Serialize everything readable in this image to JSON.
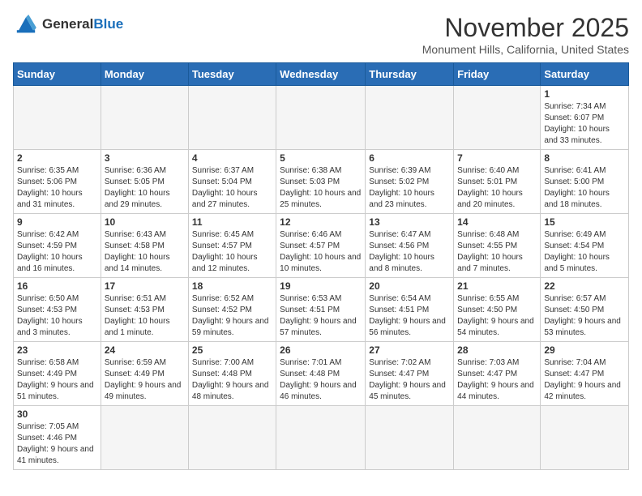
{
  "header": {
    "logo_general": "General",
    "logo_blue": "Blue",
    "month_title": "November 2025",
    "subtitle": "Monument Hills, California, United States"
  },
  "weekdays": [
    "Sunday",
    "Monday",
    "Tuesday",
    "Wednesday",
    "Thursday",
    "Friday",
    "Saturday"
  ],
  "weeks": [
    [
      {
        "day": "",
        "info": ""
      },
      {
        "day": "",
        "info": ""
      },
      {
        "day": "",
        "info": ""
      },
      {
        "day": "",
        "info": ""
      },
      {
        "day": "",
        "info": ""
      },
      {
        "day": "",
        "info": ""
      },
      {
        "day": "1",
        "info": "Sunrise: 7:34 AM\nSunset: 6:07 PM\nDaylight: 10 hours and 33 minutes."
      }
    ],
    [
      {
        "day": "2",
        "info": "Sunrise: 6:35 AM\nSunset: 5:06 PM\nDaylight: 10 hours and 31 minutes."
      },
      {
        "day": "3",
        "info": "Sunrise: 6:36 AM\nSunset: 5:05 PM\nDaylight: 10 hours and 29 minutes."
      },
      {
        "day": "4",
        "info": "Sunrise: 6:37 AM\nSunset: 5:04 PM\nDaylight: 10 hours and 27 minutes."
      },
      {
        "day": "5",
        "info": "Sunrise: 6:38 AM\nSunset: 5:03 PM\nDaylight: 10 hours and 25 minutes."
      },
      {
        "day": "6",
        "info": "Sunrise: 6:39 AM\nSunset: 5:02 PM\nDaylight: 10 hours and 23 minutes."
      },
      {
        "day": "7",
        "info": "Sunrise: 6:40 AM\nSunset: 5:01 PM\nDaylight: 10 hours and 20 minutes."
      },
      {
        "day": "8",
        "info": "Sunrise: 6:41 AM\nSunset: 5:00 PM\nDaylight: 10 hours and 18 minutes."
      }
    ],
    [
      {
        "day": "9",
        "info": "Sunrise: 6:42 AM\nSunset: 4:59 PM\nDaylight: 10 hours and 16 minutes."
      },
      {
        "day": "10",
        "info": "Sunrise: 6:43 AM\nSunset: 4:58 PM\nDaylight: 10 hours and 14 minutes."
      },
      {
        "day": "11",
        "info": "Sunrise: 6:45 AM\nSunset: 4:57 PM\nDaylight: 10 hours and 12 minutes."
      },
      {
        "day": "12",
        "info": "Sunrise: 6:46 AM\nSunset: 4:57 PM\nDaylight: 10 hours and 10 minutes."
      },
      {
        "day": "13",
        "info": "Sunrise: 6:47 AM\nSunset: 4:56 PM\nDaylight: 10 hours and 8 minutes."
      },
      {
        "day": "14",
        "info": "Sunrise: 6:48 AM\nSunset: 4:55 PM\nDaylight: 10 hours and 7 minutes."
      },
      {
        "day": "15",
        "info": "Sunrise: 6:49 AM\nSunset: 4:54 PM\nDaylight: 10 hours and 5 minutes."
      }
    ],
    [
      {
        "day": "16",
        "info": "Sunrise: 6:50 AM\nSunset: 4:53 PM\nDaylight: 10 hours and 3 minutes."
      },
      {
        "day": "17",
        "info": "Sunrise: 6:51 AM\nSunset: 4:53 PM\nDaylight: 10 hours and 1 minute."
      },
      {
        "day": "18",
        "info": "Sunrise: 6:52 AM\nSunset: 4:52 PM\nDaylight: 9 hours and 59 minutes."
      },
      {
        "day": "19",
        "info": "Sunrise: 6:53 AM\nSunset: 4:51 PM\nDaylight: 9 hours and 57 minutes."
      },
      {
        "day": "20",
        "info": "Sunrise: 6:54 AM\nSunset: 4:51 PM\nDaylight: 9 hours and 56 minutes."
      },
      {
        "day": "21",
        "info": "Sunrise: 6:55 AM\nSunset: 4:50 PM\nDaylight: 9 hours and 54 minutes."
      },
      {
        "day": "22",
        "info": "Sunrise: 6:57 AM\nSunset: 4:50 PM\nDaylight: 9 hours and 53 minutes."
      }
    ],
    [
      {
        "day": "23",
        "info": "Sunrise: 6:58 AM\nSunset: 4:49 PM\nDaylight: 9 hours and 51 minutes."
      },
      {
        "day": "24",
        "info": "Sunrise: 6:59 AM\nSunset: 4:49 PM\nDaylight: 9 hours and 49 minutes."
      },
      {
        "day": "25",
        "info": "Sunrise: 7:00 AM\nSunset: 4:48 PM\nDaylight: 9 hours and 48 minutes."
      },
      {
        "day": "26",
        "info": "Sunrise: 7:01 AM\nSunset: 4:48 PM\nDaylight: 9 hours and 46 minutes."
      },
      {
        "day": "27",
        "info": "Sunrise: 7:02 AM\nSunset: 4:47 PM\nDaylight: 9 hours and 45 minutes."
      },
      {
        "day": "28",
        "info": "Sunrise: 7:03 AM\nSunset: 4:47 PM\nDaylight: 9 hours and 44 minutes."
      },
      {
        "day": "29",
        "info": "Sunrise: 7:04 AM\nSunset: 4:47 PM\nDaylight: 9 hours and 42 minutes."
      }
    ],
    [
      {
        "day": "30",
        "info": "Sunrise: 7:05 AM\nSunset: 4:46 PM\nDaylight: 9 hours and 41 minutes."
      },
      {
        "day": "",
        "info": ""
      },
      {
        "day": "",
        "info": ""
      },
      {
        "day": "",
        "info": ""
      },
      {
        "day": "",
        "info": ""
      },
      {
        "day": "",
        "info": ""
      },
      {
        "day": "",
        "info": ""
      }
    ]
  ]
}
